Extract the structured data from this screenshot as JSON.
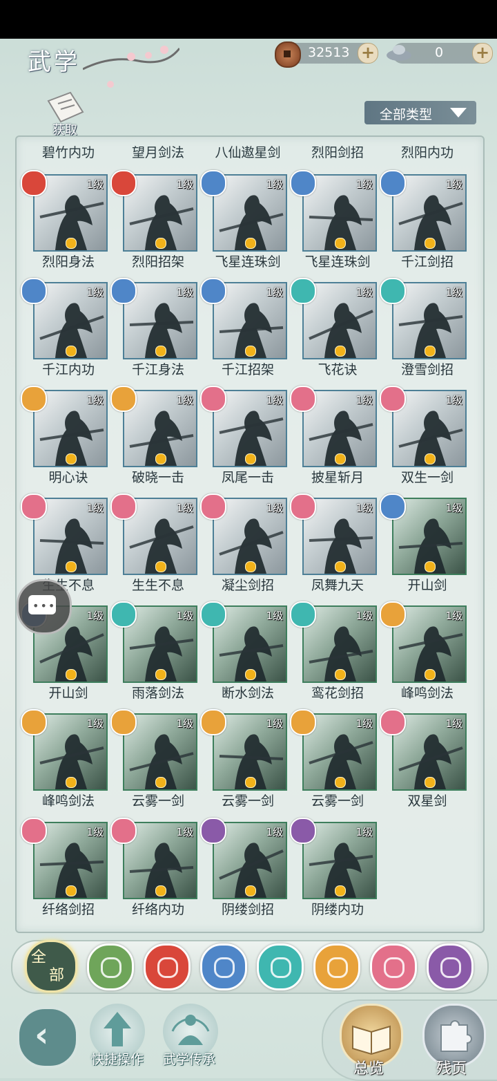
{
  "header": {
    "title": "武学",
    "copper": "32513",
    "silver": "0",
    "get_label": "获取",
    "type_filter": "全部类型"
  },
  "top_row": [
    "碧竹内功",
    "望月剑法",
    "八仙遨星剑",
    "烈阳剑招",
    "烈阳内功"
  ],
  "skills": [
    {
      "name": "烈阳身法",
      "level": "1级",
      "school": "fire"
    },
    {
      "name": "烈阳招架",
      "level": "1级",
      "school": "fire"
    },
    {
      "name": "飞星连珠剑",
      "level": "1级",
      "school": "wave"
    },
    {
      "name": "飞星连珠剑",
      "level": "1级",
      "school": "wave"
    },
    {
      "name": "千江剑招",
      "level": "1级",
      "school": "wave"
    },
    {
      "name": "千江内功",
      "level": "1级",
      "school": "wave"
    },
    {
      "name": "千江身法",
      "level": "1级",
      "school": "wave"
    },
    {
      "name": "千江招架",
      "level": "1级",
      "school": "wave"
    },
    {
      "name": "飞花诀",
      "level": "1级",
      "school": "butterfly"
    },
    {
      "name": "澄雪剑招",
      "level": "1级",
      "school": "butterfly"
    },
    {
      "name": "明心诀",
      "level": "1级",
      "school": "shield"
    },
    {
      "name": "破晓一击",
      "level": "1级",
      "school": "shield"
    },
    {
      "name": "凤尾一击",
      "level": "1级",
      "school": "moon"
    },
    {
      "name": "披星斩月",
      "level": "1级",
      "school": "moon"
    },
    {
      "name": "双生一剑",
      "level": "1级",
      "school": "moon"
    },
    {
      "name": "生生不息",
      "level": "1级",
      "school": "moon"
    },
    {
      "name": "生生不息",
      "level": "1级",
      "school": "moon"
    },
    {
      "name": "凝尘剑招",
      "level": "1级",
      "school": "moon"
    },
    {
      "name": "凤舞九天",
      "level": "1级",
      "school": "moon"
    },
    {
      "name": "开山剑",
      "level": "1级",
      "school": "wave"
    },
    {
      "name": "开山剑",
      "level": "1级",
      "school": "wave"
    },
    {
      "name": "雨落剑法",
      "level": "1级",
      "school": "butterfly"
    },
    {
      "name": "断水剑法",
      "level": "1级",
      "school": "butterfly"
    },
    {
      "name": "鸾花剑招",
      "level": "1级",
      "school": "butterfly"
    },
    {
      "name": "峰鸣剑法",
      "level": "1级",
      "school": "shield"
    },
    {
      "name": "峰鸣剑法",
      "level": "1级",
      "school": "shield"
    },
    {
      "name": "云雾一剑",
      "level": "1级",
      "school": "shield"
    },
    {
      "name": "云雾一剑",
      "level": "1级",
      "school": "shield"
    },
    {
      "name": "云雾一剑",
      "level": "1级",
      "school": "shield"
    },
    {
      "name": "双星剑",
      "level": "1级",
      "school": "moon"
    },
    {
      "name": "纤络剑招",
      "level": "1级",
      "school": "moon"
    },
    {
      "name": "纤络内功",
      "level": "1级",
      "school": "moon"
    },
    {
      "name": "阴缕剑招",
      "level": "1级",
      "school": "rose"
    },
    {
      "name": "阴缕内功",
      "level": "1级",
      "school": "rose"
    }
  ],
  "school_colors": {
    "fire": "#d9473a",
    "wave": "#4f86c8",
    "butterfly": "#3fb7b0",
    "shield": "#e8a23a",
    "moon": "#e3708a",
    "rose": "#8a5aa8",
    "sword": "#6fa55a"
  },
  "filters": {
    "all_top": "全",
    "all_bottom": "部",
    "icons": [
      "sword-icon",
      "fire-icon",
      "wave-icon",
      "butterfly-icon",
      "shield-icon",
      "moon-icon",
      "rose-icon"
    ]
  },
  "bottom": {
    "quick_ops": "快捷操作",
    "inherit": "武学传承",
    "overview": "总览",
    "fragments": "残页"
  }
}
